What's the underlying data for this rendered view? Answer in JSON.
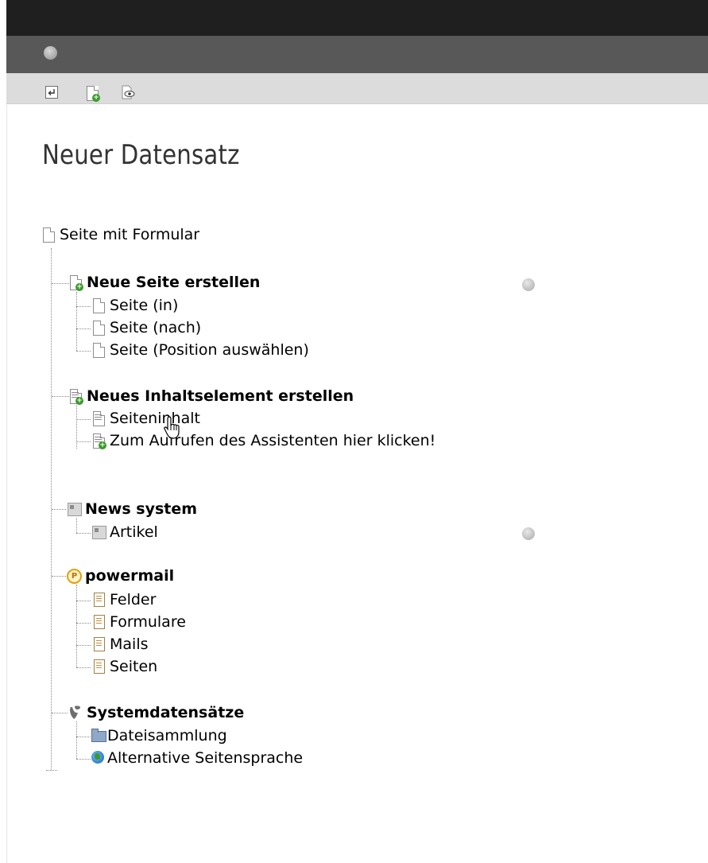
{
  "page": {
    "title": "Neuer Datensatz"
  },
  "toolbar": {
    "buttons": [
      {
        "name": "back-button",
        "icon": "return-arrow-icon"
      },
      {
        "name": "new-page-button",
        "icon": "page-new-icon"
      },
      {
        "name": "view-page-button",
        "icon": "page-view-icon"
      }
    ]
  },
  "tree": {
    "root": {
      "label": "Seite mit Formular",
      "icon": "page-icon"
    },
    "groups": [
      {
        "label": "Neue Seite erstellen",
        "icon": "page-new-icon",
        "help": true,
        "items": [
          {
            "label": "Seite (in)",
            "icon": "page-icon"
          },
          {
            "label": "Seite (nach)",
            "icon": "page-icon"
          },
          {
            "label": "Seite (Position auswählen)",
            "icon": "page-icon"
          }
        ]
      },
      {
        "label": "Neues Inhaltselement erstellen",
        "icon": "content-new-icon",
        "help": false,
        "items": [
          {
            "label": "Seiteninhalt",
            "icon": "content-icon"
          },
          {
            "label": "Zum Aufrufen des Assistenten hier klicken!",
            "icon": "content-new-icon"
          }
        ]
      },
      {
        "label": "News system",
        "icon": "news-icon",
        "help": false,
        "items": [
          {
            "label": "Artikel",
            "icon": "news-icon",
            "help": true
          }
        ]
      },
      {
        "label": "powermail",
        "icon": "powermail-icon",
        "help": false,
        "items": [
          {
            "label": "Felder",
            "icon": "powermail-doc-icon"
          },
          {
            "label": "Formulare",
            "icon": "powermail-doc-icon"
          },
          {
            "label": "Mails",
            "icon": "powermail-doc-icon"
          },
          {
            "label": "Seiten",
            "icon": "powermail-doc-icon"
          }
        ]
      },
      {
        "label": "Systemdatensätze",
        "icon": "typo3-icon",
        "help": false,
        "items": [
          {
            "label": "Dateisammlung",
            "icon": "folder-icon"
          },
          {
            "label": "Alternative Seitensprache",
            "icon": "globe-icon"
          }
        ]
      }
    ]
  },
  "colors": {
    "topbar": "#1f1f1f",
    "docheader": "#585858",
    "toolbar": "#dcdcdc",
    "title": "#333333"
  }
}
